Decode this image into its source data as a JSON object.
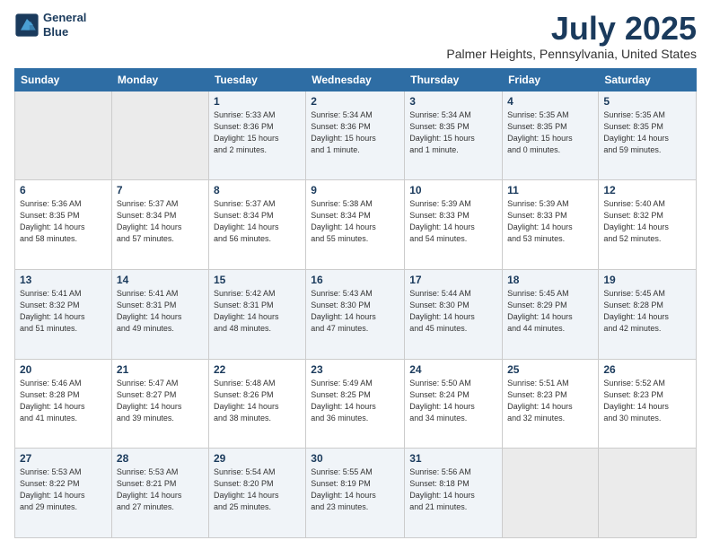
{
  "logo": {
    "line1": "General",
    "line2": "Blue"
  },
  "title": "July 2025",
  "subtitle": "Palmer Heights, Pennsylvania, United States",
  "weekdays": [
    "Sunday",
    "Monday",
    "Tuesday",
    "Wednesday",
    "Thursday",
    "Friday",
    "Saturday"
  ],
  "weeks": [
    [
      {
        "day": "",
        "info": ""
      },
      {
        "day": "",
        "info": ""
      },
      {
        "day": "1",
        "info": "Sunrise: 5:33 AM\nSunset: 8:36 PM\nDaylight: 15 hours\nand 2 minutes."
      },
      {
        "day": "2",
        "info": "Sunrise: 5:34 AM\nSunset: 8:36 PM\nDaylight: 15 hours\nand 1 minute."
      },
      {
        "day": "3",
        "info": "Sunrise: 5:34 AM\nSunset: 8:35 PM\nDaylight: 15 hours\nand 1 minute."
      },
      {
        "day": "4",
        "info": "Sunrise: 5:35 AM\nSunset: 8:35 PM\nDaylight: 15 hours\nand 0 minutes."
      },
      {
        "day": "5",
        "info": "Sunrise: 5:35 AM\nSunset: 8:35 PM\nDaylight: 14 hours\nand 59 minutes."
      }
    ],
    [
      {
        "day": "6",
        "info": "Sunrise: 5:36 AM\nSunset: 8:35 PM\nDaylight: 14 hours\nand 58 minutes."
      },
      {
        "day": "7",
        "info": "Sunrise: 5:37 AM\nSunset: 8:34 PM\nDaylight: 14 hours\nand 57 minutes."
      },
      {
        "day": "8",
        "info": "Sunrise: 5:37 AM\nSunset: 8:34 PM\nDaylight: 14 hours\nand 56 minutes."
      },
      {
        "day": "9",
        "info": "Sunrise: 5:38 AM\nSunset: 8:34 PM\nDaylight: 14 hours\nand 55 minutes."
      },
      {
        "day": "10",
        "info": "Sunrise: 5:39 AM\nSunset: 8:33 PM\nDaylight: 14 hours\nand 54 minutes."
      },
      {
        "day": "11",
        "info": "Sunrise: 5:39 AM\nSunset: 8:33 PM\nDaylight: 14 hours\nand 53 minutes."
      },
      {
        "day": "12",
        "info": "Sunrise: 5:40 AM\nSunset: 8:32 PM\nDaylight: 14 hours\nand 52 minutes."
      }
    ],
    [
      {
        "day": "13",
        "info": "Sunrise: 5:41 AM\nSunset: 8:32 PM\nDaylight: 14 hours\nand 51 minutes."
      },
      {
        "day": "14",
        "info": "Sunrise: 5:41 AM\nSunset: 8:31 PM\nDaylight: 14 hours\nand 49 minutes."
      },
      {
        "day": "15",
        "info": "Sunrise: 5:42 AM\nSunset: 8:31 PM\nDaylight: 14 hours\nand 48 minutes."
      },
      {
        "day": "16",
        "info": "Sunrise: 5:43 AM\nSunset: 8:30 PM\nDaylight: 14 hours\nand 47 minutes."
      },
      {
        "day": "17",
        "info": "Sunrise: 5:44 AM\nSunset: 8:30 PM\nDaylight: 14 hours\nand 45 minutes."
      },
      {
        "day": "18",
        "info": "Sunrise: 5:45 AM\nSunset: 8:29 PM\nDaylight: 14 hours\nand 44 minutes."
      },
      {
        "day": "19",
        "info": "Sunrise: 5:45 AM\nSunset: 8:28 PM\nDaylight: 14 hours\nand 42 minutes."
      }
    ],
    [
      {
        "day": "20",
        "info": "Sunrise: 5:46 AM\nSunset: 8:28 PM\nDaylight: 14 hours\nand 41 minutes."
      },
      {
        "day": "21",
        "info": "Sunrise: 5:47 AM\nSunset: 8:27 PM\nDaylight: 14 hours\nand 39 minutes."
      },
      {
        "day": "22",
        "info": "Sunrise: 5:48 AM\nSunset: 8:26 PM\nDaylight: 14 hours\nand 38 minutes."
      },
      {
        "day": "23",
        "info": "Sunrise: 5:49 AM\nSunset: 8:25 PM\nDaylight: 14 hours\nand 36 minutes."
      },
      {
        "day": "24",
        "info": "Sunrise: 5:50 AM\nSunset: 8:24 PM\nDaylight: 14 hours\nand 34 minutes."
      },
      {
        "day": "25",
        "info": "Sunrise: 5:51 AM\nSunset: 8:23 PM\nDaylight: 14 hours\nand 32 minutes."
      },
      {
        "day": "26",
        "info": "Sunrise: 5:52 AM\nSunset: 8:23 PM\nDaylight: 14 hours\nand 30 minutes."
      }
    ],
    [
      {
        "day": "27",
        "info": "Sunrise: 5:53 AM\nSunset: 8:22 PM\nDaylight: 14 hours\nand 29 minutes."
      },
      {
        "day": "28",
        "info": "Sunrise: 5:53 AM\nSunset: 8:21 PM\nDaylight: 14 hours\nand 27 minutes."
      },
      {
        "day": "29",
        "info": "Sunrise: 5:54 AM\nSunset: 8:20 PM\nDaylight: 14 hours\nand 25 minutes."
      },
      {
        "day": "30",
        "info": "Sunrise: 5:55 AM\nSunset: 8:19 PM\nDaylight: 14 hours\nand 23 minutes."
      },
      {
        "day": "31",
        "info": "Sunrise: 5:56 AM\nSunset: 8:18 PM\nDaylight: 14 hours\nand 21 minutes."
      },
      {
        "day": "",
        "info": ""
      },
      {
        "day": "",
        "info": ""
      }
    ]
  ]
}
